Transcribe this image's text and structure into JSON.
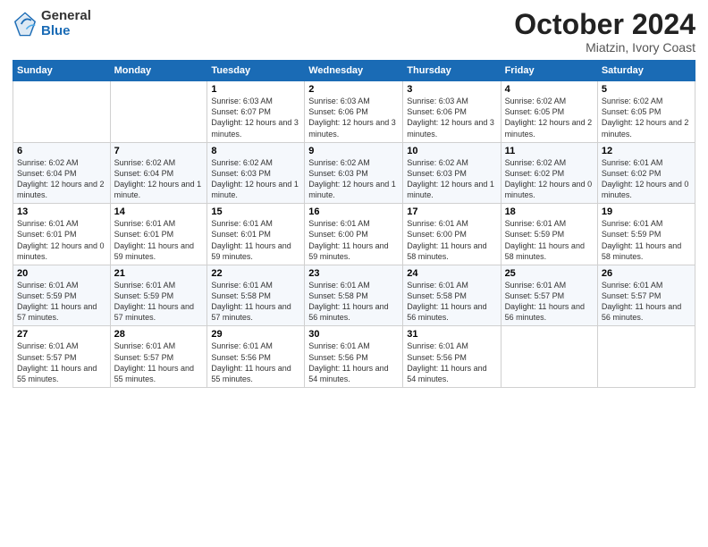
{
  "logo": {
    "text_general": "General",
    "text_blue": "Blue"
  },
  "header": {
    "month": "October 2024",
    "location": "Miatzin, Ivory Coast"
  },
  "days_of_week": [
    "Sunday",
    "Monday",
    "Tuesday",
    "Wednesday",
    "Thursday",
    "Friday",
    "Saturday"
  ],
  "weeks": [
    [
      {
        "day": "",
        "info": ""
      },
      {
        "day": "",
        "info": ""
      },
      {
        "day": "1",
        "info": "Sunrise: 6:03 AM\nSunset: 6:07 PM\nDaylight: 12 hours and 3 minutes."
      },
      {
        "day": "2",
        "info": "Sunrise: 6:03 AM\nSunset: 6:06 PM\nDaylight: 12 hours and 3 minutes."
      },
      {
        "day": "3",
        "info": "Sunrise: 6:03 AM\nSunset: 6:06 PM\nDaylight: 12 hours and 3 minutes."
      },
      {
        "day": "4",
        "info": "Sunrise: 6:02 AM\nSunset: 6:05 PM\nDaylight: 12 hours and 2 minutes."
      },
      {
        "day": "5",
        "info": "Sunrise: 6:02 AM\nSunset: 6:05 PM\nDaylight: 12 hours and 2 minutes."
      }
    ],
    [
      {
        "day": "6",
        "info": "Sunrise: 6:02 AM\nSunset: 6:04 PM\nDaylight: 12 hours and 2 minutes."
      },
      {
        "day": "7",
        "info": "Sunrise: 6:02 AM\nSunset: 6:04 PM\nDaylight: 12 hours and 1 minute."
      },
      {
        "day": "8",
        "info": "Sunrise: 6:02 AM\nSunset: 6:03 PM\nDaylight: 12 hours and 1 minute."
      },
      {
        "day": "9",
        "info": "Sunrise: 6:02 AM\nSunset: 6:03 PM\nDaylight: 12 hours and 1 minute."
      },
      {
        "day": "10",
        "info": "Sunrise: 6:02 AM\nSunset: 6:03 PM\nDaylight: 12 hours and 1 minute."
      },
      {
        "day": "11",
        "info": "Sunrise: 6:02 AM\nSunset: 6:02 PM\nDaylight: 12 hours and 0 minutes."
      },
      {
        "day": "12",
        "info": "Sunrise: 6:01 AM\nSunset: 6:02 PM\nDaylight: 12 hours and 0 minutes."
      }
    ],
    [
      {
        "day": "13",
        "info": "Sunrise: 6:01 AM\nSunset: 6:01 PM\nDaylight: 12 hours and 0 minutes."
      },
      {
        "day": "14",
        "info": "Sunrise: 6:01 AM\nSunset: 6:01 PM\nDaylight: 11 hours and 59 minutes."
      },
      {
        "day": "15",
        "info": "Sunrise: 6:01 AM\nSunset: 6:01 PM\nDaylight: 11 hours and 59 minutes."
      },
      {
        "day": "16",
        "info": "Sunrise: 6:01 AM\nSunset: 6:00 PM\nDaylight: 11 hours and 59 minutes."
      },
      {
        "day": "17",
        "info": "Sunrise: 6:01 AM\nSunset: 6:00 PM\nDaylight: 11 hours and 58 minutes."
      },
      {
        "day": "18",
        "info": "Sunrise: 6:01 AM\nSunset: 5:59 PM\nDaylight: 11 hours and 58 minutes."
      },
      {
        "day": "19",
        "info": "Sunrise: 6:01 AM\nSunset: 5:59 PM\nDaylight: 11 hours and 58 minutes."
      }
    ],
    [
      {
        "day": "20",
        "info": "Sunrise: 6:01 AM\nSunset: 5:59 PM\nDaylight: 11 hours and 57 minutes."
      },
      {
        "day": "21",
        "info": "Sunrise: 6:01 AM\nSunset: 5:59 PM\nDaylight: 11 hours and 57 minutes."
      },
      {
        "day": "22",
        "info": "Sunrise: 6:01 AM\nSunset: 5:58 PM\nDaylight: 11 hours and 57 minutes."
      },
      {
        "day": "23",
        "info": "Sunrise: 6:01 AM\nSunset: 5:58 PM\nDaylight: 11 hours and 56 minutes."
      },
      {
        "day": "24",
        "info": "Sunrise: 6:01 AM\nSunset: 5:58 PM\nDaylight: 11 hours and 56 minutes."
      },
      {
        "day": "25",
        "info": "Sunrise: 6:01 AM\nSunset: 5:57 PM\nDaylight: 11 hours and 56 minutes."
      },
      {
        "day": "26",
        "info": "Sunrise: 6:01 AM\nSunset: 5:57 PM\nDaylight: 11 hours and 56 minutes."
      }
    ],
    [
      {
        "day": "27",
        "info": "Sunrise: 6:01 AM\nSunset: 5:57 PM\nDaylight: 11 hours and 55 minutes."
      },
      {
        "day": "28",
        "info": "Sunrise: 6:01 AM\nSunset: 5:57 PM\nDaylight: 11 hours and 55 minutes."
      },
      {
        "day": "29",
        "info": "Sunrise: 6:01 AM\nSunset: 5:56 PM\nDaylight: 11 hours and 55 minutes."
      },
      {
        "day": "30",
        "info": "Sunrise: 6:01 AM\nSunset: 5:56 PM\nDaylight: 11 hours and 54 minutes."
      },
      {
        "day": "31",
        "info": "Sunrise: 6:01 AM\nSunset: 5:56 PM\nDaylight: 11 hours and 54 minutes."
      },
      {
        "day": "",
        "info": ""
      },
      {
        "day": "",
        "info": ""
      }
    ]
  ]
}
